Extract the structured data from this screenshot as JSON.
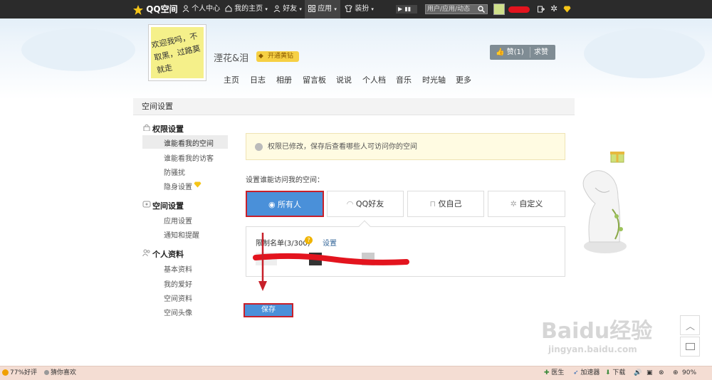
{
  "topbar": {
    "brand": "QQ空间",
    "personal_center": "个人中心",
    "my_home": "我的主页",
    "friends": "好友",
    "apps": "应用",
    "dress": "装扮",
    "search_placeholder": "用户/应用/动态"
  },
  "profile": {
    "username": "湮花&泪",
    "vip_label": "开通黄钻",
    "avatar_text": "欢迎我吗，不取黑，过路莫就走"
  },
  "nav": {
    "items": [
      "主页",
      "日志",
      "相册",
      "留言板",
      "说说",
      "个人档",
      "音乐",
      "时光轴",
      "更多"
    ]
  },
  "actions": {
    "like_label": "赞(1)",
    "ask_like_label": "求赞"
  },
  "panel": {
    "title": "空间设置"
  },
  "sidebar": {
    "groups": [
      {
        "title": "权限设置",
        "items": [
          "谁能看我的空间",
          "谁能看我的访客",
          "防骚扰",
          "隐身设置"
        ]
      },
      {
        "title": "空间设置",
        "items": [
          "应用设置",
          "通知和提醒"
        ]
      },
      {
        "title": "个人资料",
        "items": [
          "基本资料",
          "我的爱好",
          "空间资料",
          "空间头像"
        ]
      }
    ]
  },
  "main": {
    "notice": "权限已修改，保存后查看哪些人可访问你的空间",
    "setting_label": "设置谁能访问我的空间：",
    "options": [
      "所有人",
      "QQ好友",
      "仅自己",
      "自定义"
    ],
    "selected_option": "所有人",
    "limit_label": "限制名单(3/300)",
    "help_symbol": "?",
    "settings_link": "设置",
    "save_label": "保存"
  },
  "watermark": {
    "main": "Baidu经验",
    "sub": "jingyan.baidu.com"
  },
  "statusbar": {
    "rating": "77%好评",
    "guess": "猜你喜欢",
    "doctor": "医生",
    "accelerator": "加速器",
    "download": "下载",
    "zoom": "90%"
  },
  "colors": {
    "accent_blue": "#4a90d9",
    "highlight_red": "#c8202a",
    "topbar": "#2b2b2b"
  }
}
